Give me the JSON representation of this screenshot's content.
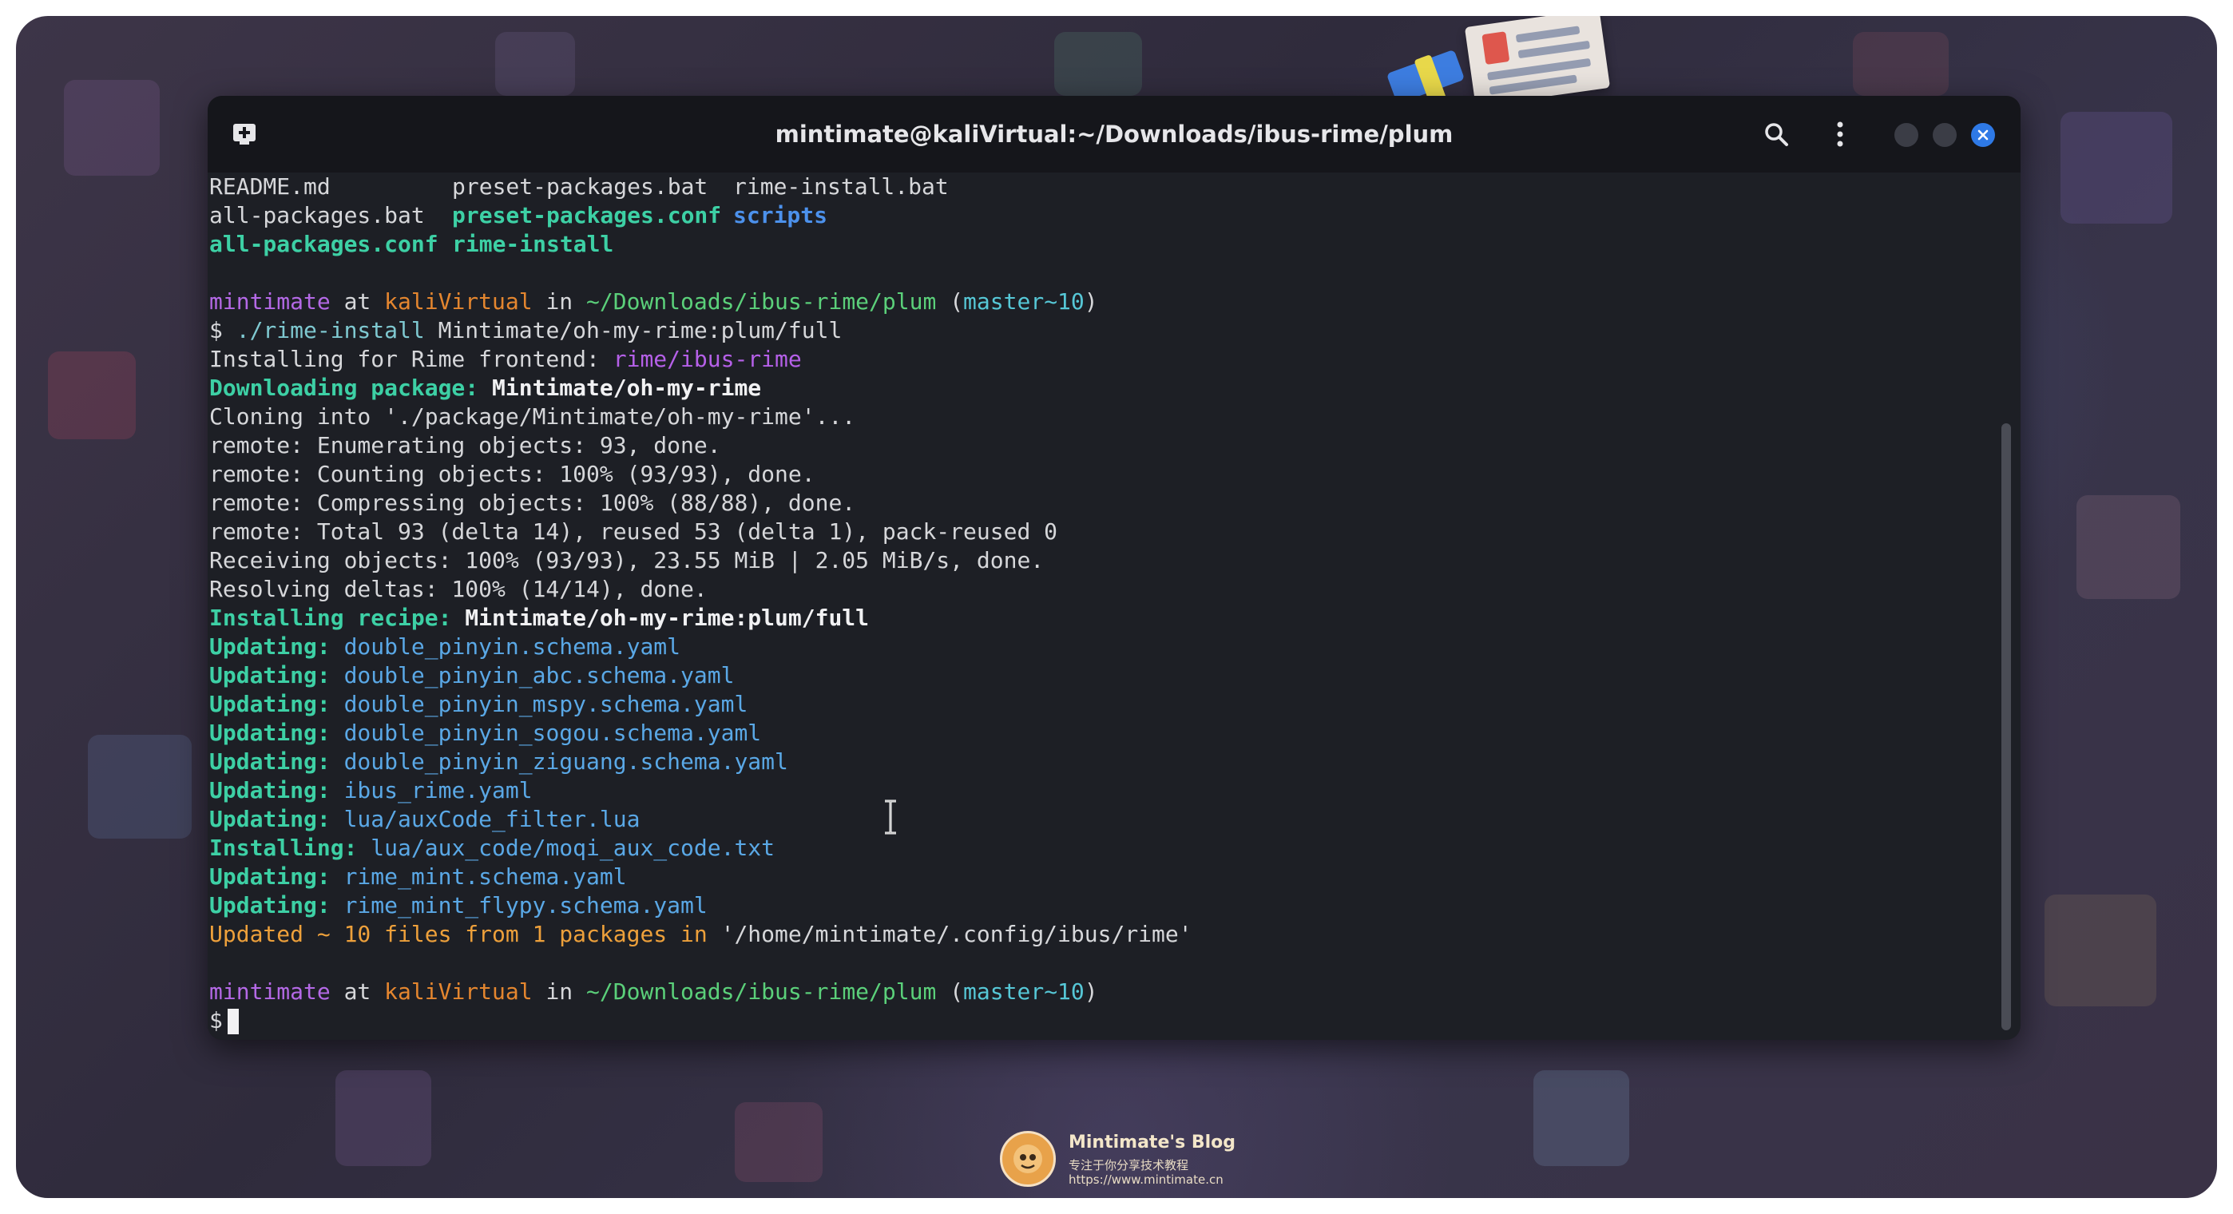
{
  "window": {
    "title": "mintimate@kaliVirtual:~/Downloads/ibus-rime/plum"
  },
  "titlebar": {
    "new_tab_icon": "new-tab-icon",
    "search_icon": "search-icon",
    "menu_icon": "kebab-menu-icon",
    "minimize_icon": "minimize-icon",
    "maximize_icon": "maximize-icon",
    "close_icon": "close-icon"
  },
  "colors": {
    "prompt_user": "#b469e6",
    "prompt_host": "#e4862f",
    "prompt_path": "#5bd07a",
    "prompt_branch": "#56c7d6",
    "updating": "#3dd0a5",
    "updated_summary": "#eda03b",
    "close_button": "#2e79e6"
  },
  "ls": {
    "row1": [
      "README.md",
      "preset-packages.bat",
      "rime-install.bat"
    ],
    "row2": [
      "all-packages.bat",
      "preset-packages.conf",
      "scripts"
    ],
    "row3": [
      "all-packages.conf",
      "rime-install"
    ]
  },
  "prompt": {
    "user": "mintimate",
    "at": "at",
    "host": "kaliVirtual",
    "in": "in",
    "path": "~/Downloads/ibus-rime/plum",
    "open_paren": "(",
    "branch": "master~10",
    "close_paren": ")",
    "symbol": "$"
  },
  "command": {
    "program": "./rime-install",
    "argument": "Mintimate/oh-my-rime:plum/full"
  },
  "output": {
    "installing_for_label": "Installing for Rime frontend: ",
    "frontend": "rime/ibus-rime",
    "downloading_label": "Downloading package: ",
    "downloading_package": "Mintimate/oh-my-rime",
    "cloning": "Cloning into './package/Mintimate/oh-my-rime'...",
    "remote_enumerating": "remote: Enumerating objects: 93, done.",
    "remote_counting": "remote: Counting objects: 100% (93/93), done.",
    "remote_compressing": "remote: Compressing objects: 100% (88/88), done.",
    "remote_total": "remote: Total 93 (delta 14), reused 53 (delta 1), pack-reused 0",
    "receiving": "Receiving objects: 100% (93/93), 23.55 MiB | 2.05 MiB/s, done.",
    "resolving": "Resolving deltas: 100% (14/14), done.",
    "recipe_label": "Installing recipe: ",
    "recipe": "Mintimate/oh-my-rime:plum/full",
    "files": [
      {
        "action": "Updating:",
        "file": "double_pinyin.schema.yaml"
      },
      {
        "action": "Updating:",
        "file": "double_pinyin_abc.schema.yaml"
      },
      {
        "action": "Updating:",
        "file": "double_pinyin_mspy.schema.yaml"
      },
      {
        "action": "Updating:",
        "file": "double_pinyin_sogou.schema.yaml"
      },
      {
        "action": "Updating:",
        "file": "double_pinyin_ziguang.schema.yaml"
      },
      {
        "action": "Updating:",
        "file": "ibus_rime.yaml"
      },
      {
        "action": "Updating:",
        "file": "lua/auxCode_filter.lua"
      },
      {
        "action": "Installing:",
        "file": "lua/aux_code/moqi_aux_code.txt"
      },
      {
        "action": "Updating:",
        "file": "rime_mint.schema.yaml"
      },
      {
        "action": "Updating:",
        "file": "rime_mint_flypy.schema.yaml"
      }
    ],
    "summary_prefix": "Updated ~ 10 files from 1 packages in ",
    "summary_path": "'/home/mintimate/.config/ibus/rime'"
  },
  "watermark": {
    "title": "Mintimate's Blog",
    "subtitle": "专注于你分享技术教程",
    "url": "https://www.mintimate.cn"
  }
}
